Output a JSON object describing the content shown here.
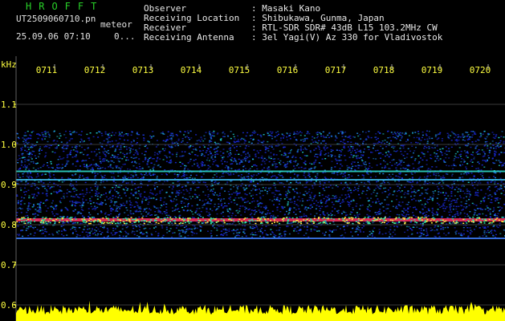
{
  "header": {
    "brand": "HROFFT",
    "filename": "UT2509060710.pn",
    "tag": "meteor",
    "date_time": "25.09.06 07:10",
    "extra": "0..."
  },
  "info": [
    {
      "label": "Observer",
      "value": ": Masaki Kano"
    },
    {
      "label": "Receiving Location",
      "value": ": Shibukawa, Gunma, Japan"
    },
    {
      "label": "Receiver",
      "value": ": RTL-SDR SDR# 43dB L15 103.2MHz CW"
    },
    {
      "label": "Receiving Antenna",
      "value": ": 3el Yagi(V) Az 330 for Vladivostok"
    }
  ],
  "axis": {
    "unit": "kHz",
    "y_ticks": [
      "1.1",
      "1.0",
      "0.9",
      "0.8",
      "0.7",
      "0.6"
    ],
    "x_ticks": [
      "0711",
      "0712",
      "0713",
      "0714",
      "0715",
      "0716",
      "0717",
      "0718",
      "0719",
      "0720"
    ]
  },
  "colors": {
    "background": "#000000",
    "axis_text": "#ffff40",
    "grid": "#3a3a3a",
    "brand": "#28d028",
    "signal_band": "#ff3060",
    "noise_low": "#1a2ad8",
    "noise_high": "#20d0d0",
    "power_trace": "#ffff00"
  }
}
